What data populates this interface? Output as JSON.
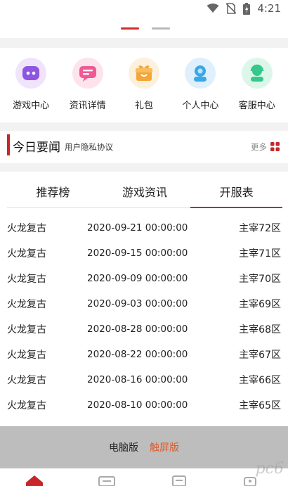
{
  "status_bar": {
    "time": "4:21"
  },
  "quick_menu": [
    {
      "label": "游戏中心",
      "icon": "gamepad-icon",
      "color": "#8e56e0"
    },
    {
      "label": "资讯详情",
      "icon": "message-icon",
      "color": "#ef5a93"
    },
    {
      "label": "礼包",
      "icon": "gift-icon",
      "color": "#f4a63a"
    },
    {
      "label": "个人中心",
      "icon": "user-icon",
      "color": "#3aa8e8"
    },
    {
      "label": "客服中心",
      "icon": "support-icon",
      "color": "#34c98a"
    }
  ],
  "news": {
    "title": "今日要闻",
    "subtitle": "用户隐私协议",
    "more": "更多"
  },
  "tabs": [
    {
      "label": "推荐榜"
    },
    {
      "label": "游戏资讯"
    },
    {
      "label": "开服表"
    }
  ],
  "active_tab": "开服表",
  "servers": [
    {
      "game": "火龙复古",
      "time": "2020-09-21 00:00:00",
      "server": "主宰72区"
    },
    {
      "game": "火龙复古",
      "time": "2020-09-15 00:00:00",
      "server": "主宰71区"
    },
    {
      "game": "火龙复古",
      "time": "2020-09-09 00:00:00",
      "server": "主宰70区"
    },
    {
      "game": "火龙复古",
      "time": "2020-09-03 00:00:00",
      "server": "主宰69区"
    },
    {
      "game": "火龙复古",
      "time": "2020-08-28 00:00:00",
      "server": "主宰68区"
    },
    {
      "game": "火龙复古",
      "time": "2020-08-22 00:00:00",
      "server": "主宰67区"
    },
    {
      "game": "火龙复古",
      "time": "2020-08-16 00:00:00",
      "server": "主宰66区"
    },
    {
      "game": "火龙复古",
      "time": "2020-08-10 00:00:00",
      "server": "主宰65区"
    }
  ],
  "footer": {
    "pc_label": "电脑版",
    "touch_label": "触屏版"
  },
  "watermark": "pc6",
  "colors": {
    "accent": "#c7262a",
    "touch": "#e0582a"
  }
}
